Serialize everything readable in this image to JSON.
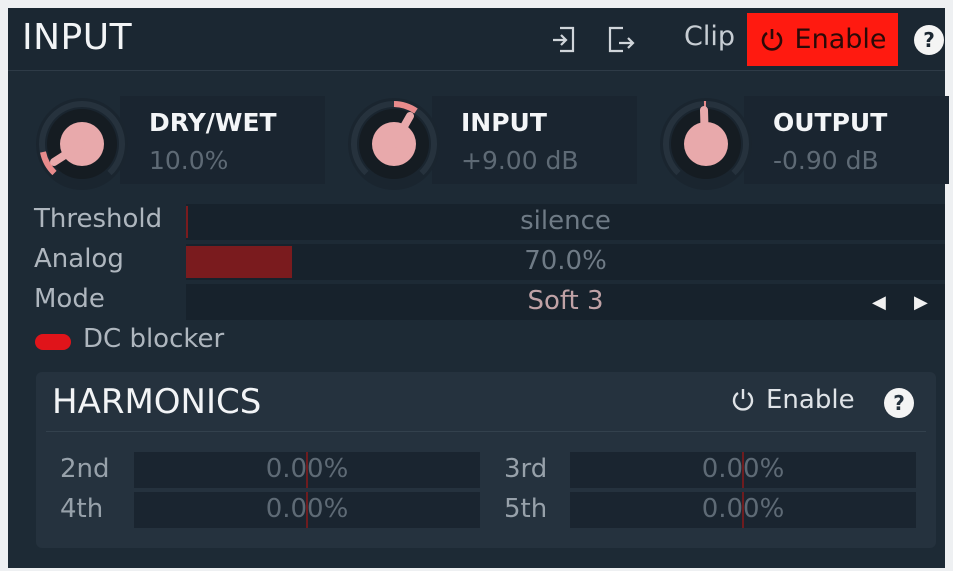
{
  "header": {
    "title": "INPUT",
    "clip_label": "Clip",
    "enable_label": "Enable",
    "help_label": "?"
  },
  "knobs": [
    {
      "label": "DRY/WET",
      "value": "10.0%"
    },
    {
      "label": "INPUT",
      "value": "+9.00 dB"
    },
    {
      "label": "OUTPUT",
      "value": "-0.90 dB"
    }
  ],
  "threshold": {
    "label": "Threshold",
    "value": "silence"
  },
  "analog": {
    "label": "Analog",
    "value": "70.0%",
    "fill_fraction": 0.14
  },
  "mode": {
    "label": "Mode",
    "value": "Soft 3"
  },
  "dc_blocker": {
    "label": "DC blocker",
    "on": true
  },
  "harmonics": {
    "title": "HARMONICS",
    "enable_label": "Enable",
    "help_label": "?",
    "items": [
      {
        "label": "2nd",
        "value": "0.00%"
      },
      {
        "label": "3rd",
        "value": "0.00%"
      },
      {
        "label": "4th",
        "value": "0.00%"
      },
      {
        "label": "5th",
        "value": "0.00%"
      }
    ]
  },
  "colors": {
    "accent_red": "#ff1a10",
    "knob_body": "#e8a9ab",
    "panel": "#1d2a35"
  }
}
